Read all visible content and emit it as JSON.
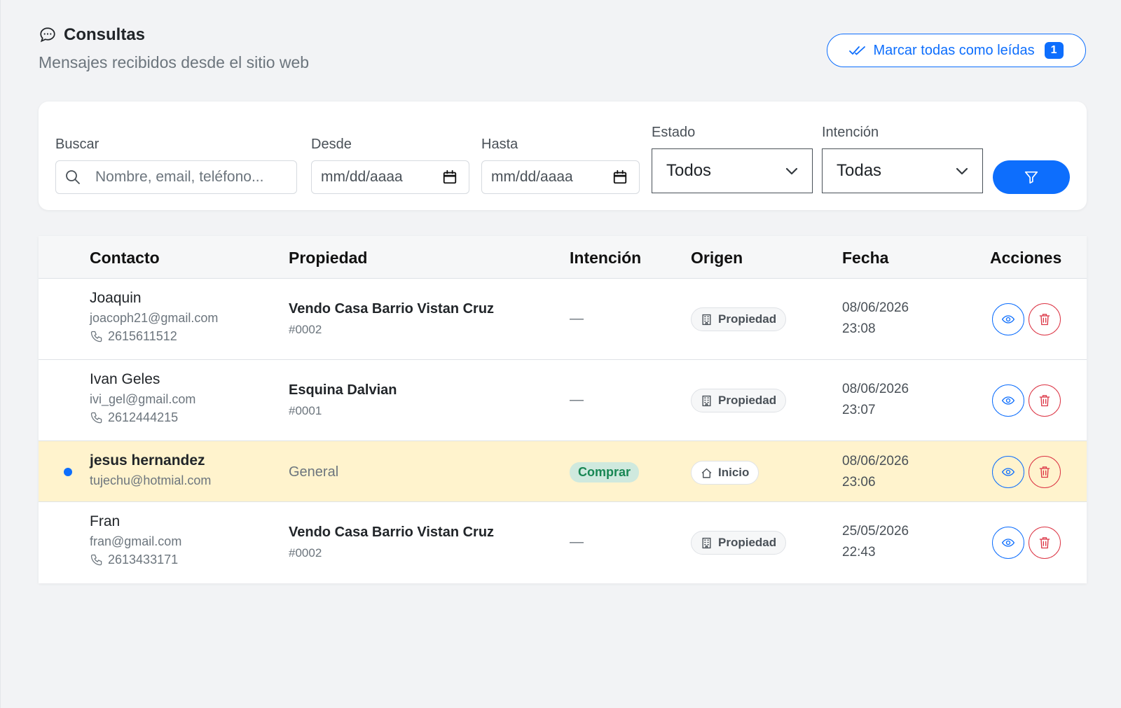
{
  "header": {
    "title": "Consultas",
    "subtitle": "Mensajes recibidos desde el sitio web",
    "mark_all_label": "Marcar todas como leídas",
    "unread_count": "1"
  },
  "filters": {
    "search_label": "Buscar",
    "search_placeholder": "Nombre, email, teléfono...",
    "from_label": "Desde",
    "from_placeholder": "mm/dd/aaaa",
    "to_label": "Hasta",
    "to_placeholder": "mm/dd/aaaa",
    "status_label": "Estado",
    "status_value": "Todos",
    "intent_label": "Intención",
    "intent_value": "Todas"
  },
  "table": {
    "headers": {
      "contact": "Contacto",
      "property": "Propiedad",
      "intent": "Intención",
      "origin": "Origen",
      "date": "Fecha",
      "actions": "Acciones"
    },
    "rows": [
      {
        "name": "Joaquin",
        "email": "joacoph21@gmail.com",
        "phone": "2615611512",
        "property_title": "Vendo Casa Barrio Vistan Cruz",
        "property_code": "#0002",
        "intent": "—",
        "origin": "Propiedad",
        "date": "08/06/2026",
        "time": "23:08"
      },
      {
        "name": "Ivan Geles",
        "email": "ivi_gel@gmail.com",
        "phone": "2612444215",
        "property_title": "Esquina Dalvian",
        "property_code": "#0001",
        "intent": "—",
        "origin": "Propiedad",
        "date": "08/06/2026",
        "time": "23:07"
      },
      {
        "name": "jesus hernandez",
        "email": "tujechu@hotmial.com",
        "property_general": "General",
        "intent": "Comprar",
        "origin": "Inicio",
        "date": "08/06/2026",
        "time": "23:06"
      },
      {
        "name": "Fran",
        "email": "fran@gmail.com",
        "phone": "2613433171",
        "property_title": "Vendo Casa Barrio Vistan Cruz",
        "property_code": "#0002",
        "intent": "—",
        "origin": "Propiedad",
        "date": "25/05/2026",
        "time": "22:43"
      }
    ]
  },
  "colors": {
    "primary": "#0d6efd",
    "danger": "#dc3545",
    "unread_row": "#fff3cd",
    "intent_badge_bg": "#cfe9de",
    "intent_badge_text": "#198754"
  },
  "icons": {
    "title": "chat-dots-icon",
    "mark_all": "double-check-icon",
    "search": "search-icon",
    "calendar": "calendar-icon",
    "select": "chevron-down-icon",
    "filter": "funnel-icon",
    "phone": "phone-icon",
    "origin_property": "building-icon",
    "origin_home": "house-icon",
    "view": "eye-icon",
    "delete": "trash-icon"
  }
}
